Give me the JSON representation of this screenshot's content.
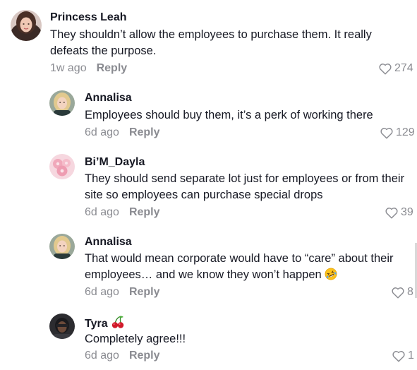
{
  "comments": [
    {
      "author": "Princess Leah",
      "text": "They shouldn’t allow the employees to purchase them. It really defeats the purpose.",
      "time": "1w ago",
      "reply_label": "Reply",
      "likes": "274",
      "avatar_icon": "avatar-photo-woman-dark-hair"
    },
    {
      "author": "Annalisa",
      "text": "Employees should buy them, it’s a perk of working there",
      "time": "6d ago",
      "reply_label": "Reply",
      "likes": "129",
      "avatar_icon": "avatar-photo-woman-blonde"
    },
    {
      "author": "Bi’M_Dayla",
      "text": "They should send separate lot just for employees or from their site so employees can purchase special drops",
      "time": "6d ago",
      "reply_label": "Reply",
      "likes": "39",
      "avatar_icon": "avatar-pink-flowers"
    },
    {
      "author": "Annalisa",
      "text": "That would mean corporate would have to “care” about their employees… and we know they won’t happen",
      "time": "6d ago",
      "reply_label": "Reply",
      "likes": "8",
      "avatar_icon": "avatar-photo-woman-blonde",
      "emoji": "rolling-on-floor-laughing-emoji"
    },
    {
      "author": "Tyra",
      "author_emoji": "cherries-emoji",
      "text": "Completely agree!!!",
      "time": "6d ago",
      "reply_label": "Reply",
      "likes": "1",
      "avatar_icon": "avatar-photo-dark"
    }
  ],
  "colors": {
    "text": "#161823",
    "muted": "#8a8b91",
    "background": "#ffffff"
  }
}
